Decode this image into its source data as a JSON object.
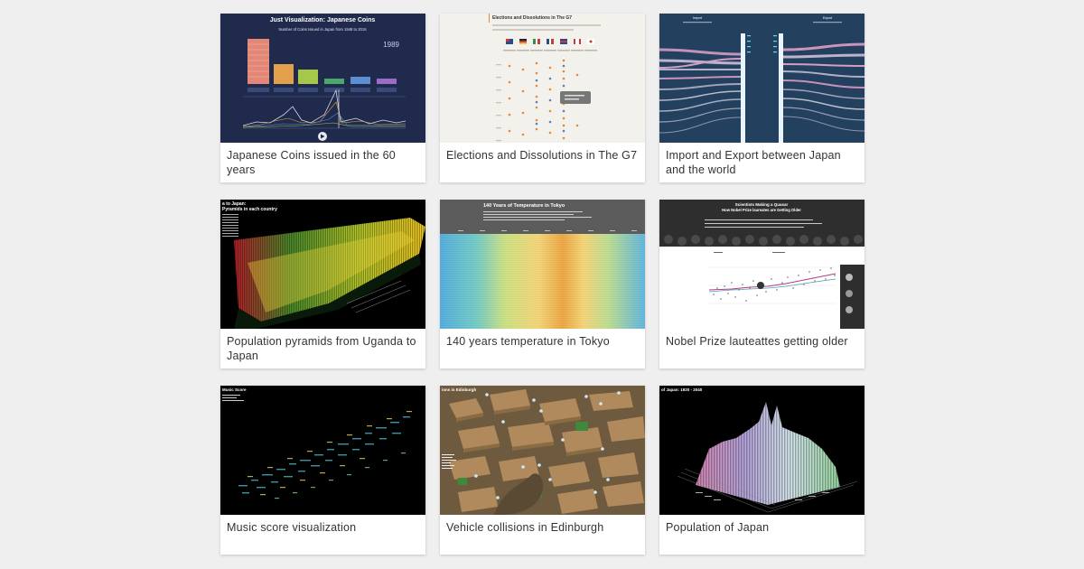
{
  "gallery": {
    "items": [
      {
        "caption": "Japanese Coins issued in the 60 years",
        "thumb": {
          "title": "Just Visualization: Japanese Coins",
          "subtitle": "Number of Coins Issued in Japan from 1948 to 2016",
          "year": "1989"
        }
      },
      {
        "caption": "Elections and Dissolutions in The G7",
        "thumb": {
          "title": "Elections and Dissolutions in The G7"
        }
      },
      {
        "caption": "Import and Export between Japan and the world",
        "thumb": {
          "left_label": "Import",
          "right_label": "Export"
        }
      },
      {
        "caption": "Population pyramids from Uganda to Japan",
        "thumb": {
          "title": "a to Japan:",
          "subtitle": "Pyramids in each country"
        }
      },
      {
        "caption": "140 years temperature in Tokyo",
        "thumb": {
          "title": "140 Years of Temperature in Tokyo"
        }
      },
      {
        "caption": "Nobel Prize lauteattes getting older",
        "thumb": {
          "title": "Scientists Making a Quasar",
          "subtitle": "How Nobel Prize laureates are Getting Older"
        }
      },
      {
        "caption": "Music score visualization",
        "thumb": {
          "title": "Music Score"
        }
      },
      {
        "caption": "Vehicle collisions in Edinburgh",
        "thumb": {
          "title": "ions in Edinburgh"
        }
      },
      {
        "caption": "Population of Japan",
        "thumb": {
          "title": "of Japan: 1920 - 2040"
        }
      }
    ]
  },
  "colors": {
    "page_background": "#efefef",
    "card_background": "#ffffff",
    "caption_text": "#333333"
  }
}
